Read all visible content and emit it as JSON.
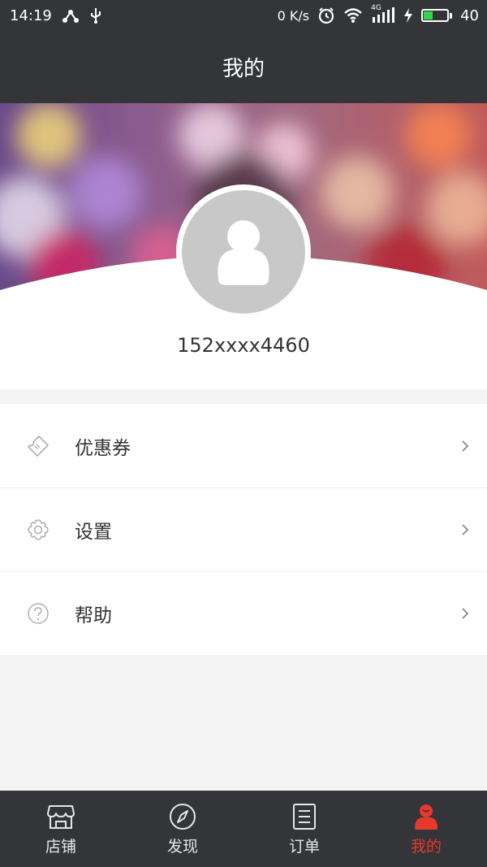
{
  "status_bar": {
    "time": "14:19",
    "net_speed": "0 K/s",
    "signal_type": "4G",
    "battery_level": "40"
  },
  "header": {
    "title": "我的"
  },
  "profile": {
    "username": "152xxxx4460"
  },
  "menu": {
    "items": [
      {
        "label": "优惠券",
        "icon": "coupon-icon"
      },
      {
        "label": "设置",
        "icon": "gear-icon"
      },
      {
        "label": "帮助",
        "icon": "help-icon"
      }
    ]
  },
  "tabs": [
    {
      "label": "店铺",
      "icon": "store-icon",
      "active": false
    },
    {
      "label": "发现",
      "icon": "compass-icon",
      "active": false
    },
    {
      "label": "订单",
      "icon": "order-list-icon",
      "active": false
    },
    {
      "label": "我的",
      "icon": "user-icon",
      "active": true
    }
  ],
  "colors": {
    "bar_bg": "#333538",
    "accent": "#e8382d",
    "page_bg": "#f4f4f4"
  }
}
